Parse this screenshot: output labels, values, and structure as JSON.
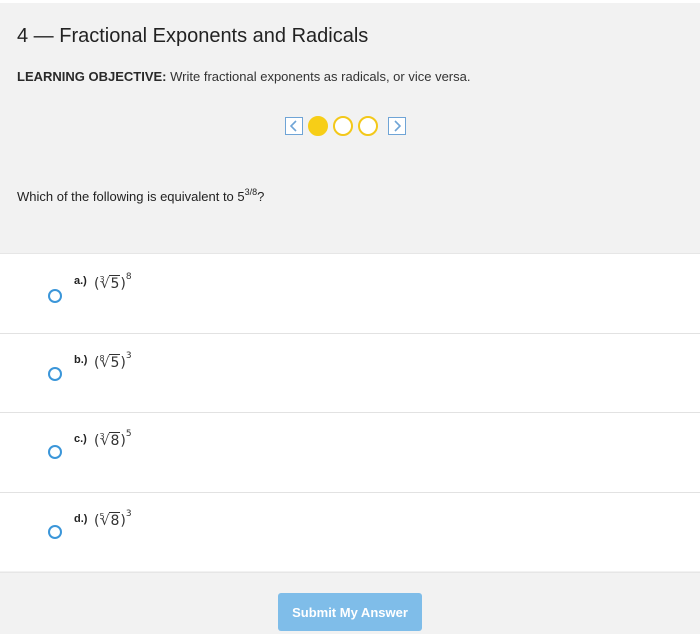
{
  "header": {
    "title": "4 — Fractional Exponents and Radicals",
    "objective_label": "LEARNING OBJECTIVE:",
    "objective_text": "Write fractional exponents as radicals, or vice versa."
  },
  "pager": {
    "prev_icon": "chevron-left-icon",
    "next_icon": "chevron-right-icon",
    "dots": 3,
    "active_index": 0,
    "accent": "#f7ce17"
  },
  "question": {
    "text": "Which of the following is equivalent to ",
    "base": "5",
    "exponent": "3/8",
    "end": "?"
  },
  "options": [
    {
      "label": "a.)",
      "index": "3",
      "radicand": "5",
      "power": "8"
    },
    {
      "label": "b.)",
      "index": "8",
      "radicand": "5",
      "power": "3"
    },
    {
      "label": "c.)",
      "index": "3",
      "radicand": "8",
      "power": "5"
    },
    {
      "label": "d.)",
      "index": "5",
      "radicand": "8",
      "power": "3"
    }
  ],
  "submit": {
    "label": "Submit My Answer",
    "color": "#7fbde9"
  },
  "colors": {
    "radio": "#3b96d9",
    "pager_border": "#6fa4d6"
  }
}
